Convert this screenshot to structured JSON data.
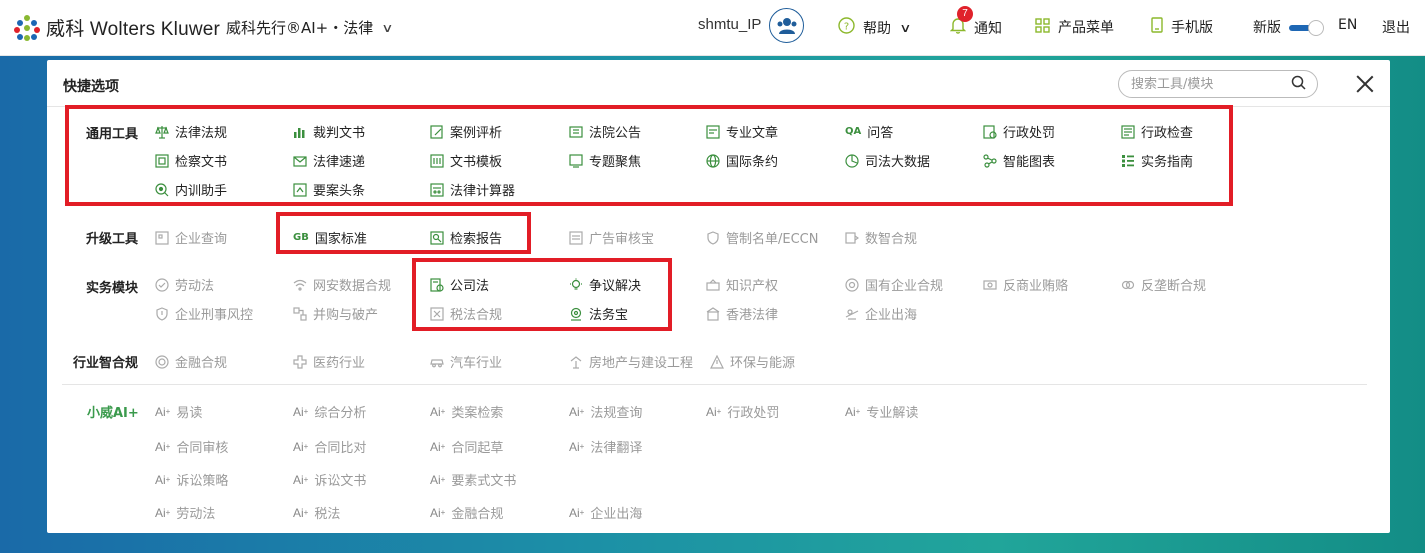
{
  "header": {
    "logo_text": "威科 Wolters Kluwer",
    "product": "威科先行®AI+・法律",
    "user": "shmtu_IP",
    "help": "帮助",
    "notify": "通知",
    "notify_count": "7",
    "products_menu": "产品菜单",
    "mobile": "手机版",
    "new_version": "新版",
    "lang": "EN",
    "logout": "退出"
  },
  "panel": {
    "title": "快捷选项",
    "search_placeholder": "搜索工具/模块"
  },
  "categories": {
    "general": "通用工具",
    "upgrade": "升级工具",
    "practice": "实务模块",
    "industry": "行业智合规",
    "ai": "小威AI+"
  },
  "general_items": [
    "法律法规",
    "裁判文书",
    "案例评析",
    "法院公告",
    "专业文章",
    "问答",
    "行政处罚",
    "行政检查",
    "检察文书",
    "法律速递",
    "文书模板",
    "专题聚焦",
    "国际条约",
    "司法大数据",
    "智能图表",
    "实务指南",
    "内训助手",
    "要案头条",
    "法律计算器"
  ],
  "upgrade_items": [
    "企业查询",
    "国家标准",
    "检索报告",
    "广告审核宝",
    "管制名单/ECCN",
    "数智合规"
  ],
  "practice_items": [
    "劳动法",
    "网安数据合规",
    "公司法",
    "争议解决",
    "知识产权",
    "国有企业合规",
    "反商业贿赂",
    "反垄断合规",
    "企业刑事风控",
    "并购与破产",
    "税法合规",
    "法务宝",
    "香港法律",
    "企业出海"
  ],
  "industry_items": [
    "金融合规",
    "医药行业",
    "汽车行业",
    "房地产与建设工程",
    "环保与能源"
  ],
  "ai_items": [
    "易读",
    "综合分析",
    "类案检索",
    "法规查询",
    "行政处罚",
    "专业解读",
    "合同审核",
    "合同比对",
    "合同起草",
    "法律翻译",
    "诉讼策略",
    "诉讼文书",
    "要素式文书",
    "劳动法",
    "税法",
    "金融合规",
    "企业出海"
  ],
  "icons": [
    "scale-icon",
    "chart-icon",
    "pen-icon",
    "announcement-icon",
    "article-icon",
    "qa-icon",
    "penalty-icon",
    "inspection-icon",
    "procuratorate-icon",
    "mail-icon",
    "template-icon",
    "topic-icon",
    "globe-icon",
    "bigdata-icon",
    "smart-chart-icon",
    "guide-icon",
    "training-icon",
    "headline-icon",
    "calculator-icon"
  ],
  "colors": {
    "accent": "#1e67b4",
    "icon_green": "#3b8f3e",
    "highlight": "#e21d26",
    "ai_green": "#3a9a4c"
  }
}
